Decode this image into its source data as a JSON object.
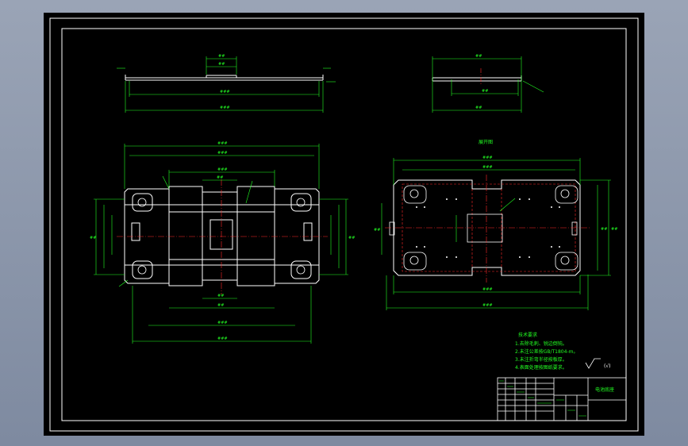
{
  "drawing": {
    "flat_pattern_label": "展开图",
    "tech_requirements": {
      "heading": "技术要求",
      "lines": [
        "1.去除毛刺、锐边倒钝。",
        "2.未注公差按GB/T1804-m。",
        "3.未注折弯半径按板厚。",
        "4.表面处理按图纸要求。"
      ]
    },
    "roughness_symbol": "(√)",
    "title_block": {
      "part_name": "电池底座",
      "drawing_number": "",
      "material": "",
      "scale": "",
      "sheet": ""
    }
  },
  "colors": {
    "background": "#000000",
    "geometry": "#ffffff",
    "dimension": "#22ff22",
    "centerline": "#ff2a2a",
    "frame": "#ffffff"
  }
}
